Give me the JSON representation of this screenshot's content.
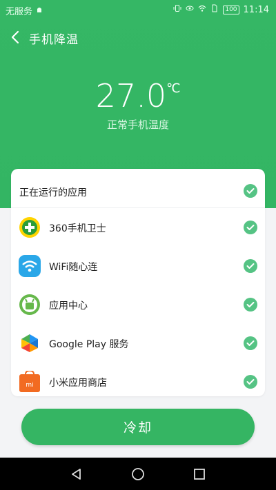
{
  "status_bar": {
    "carrier": "无服务",
    "battery": "100",
    "time": "11:14"
  },
  "header": {
    "title": "手机降温"
  },
  "temperature": {
    "value": "27.0",
    "unit": "℃",
    "caption": "正常手机温度"
  },
  "apps_card": {
    "header_label": "正在运行的应用",
    "items": [
      {
        "label": "360手机卫士",
        "icon": "360-security-icon"
      },
      {
        "label": "WiFi随心连",
        "icon": "wifi-icon"
      },
      {
        "label": "应用中心",
        "icon": "app-center-icon"
      },
      {
        "label": "Google Play 服务",
        "icon": "google-play-services-icon"
      },
      {
        "label": "小米应用商店",
        "icon": "xiaomi-store-icon"
      }
    ]
  },
  "action": {
    "cool_label": "冷却"
  },
  "colors": {
    "accent": "#35b563",
    "check": "#55c384"
  }
}
